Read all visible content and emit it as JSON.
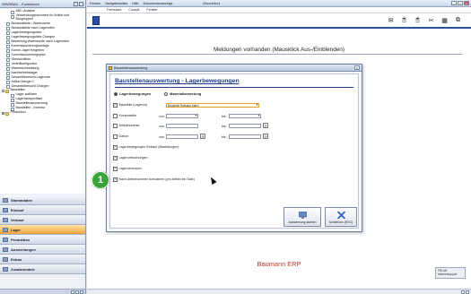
{
  "left_panel": {
    "title": "WWSBAU - Funktionen",
    "tree": [
      {
        "label": "ABC-Analyse",
        "type": "doc",
        "indent": 2
      },
      {
        "label": "Verwendungsnachweis für Artikel und Baugruppen",
        "type": "doc",
        "indent": 2
      },
      {
        "label": "Bestandsliste / Warenwerte",
        "type": "doc",
        "indent": 1
      },
      {
        "label": "Bestandsliste nach Lagerorten",
        "type": "doc",
        "indent": 1
      },
      {
        "label": "Lagerbewegungsliste",
        "type": "doc",
        "indent": 1
      },
      {
        "label": "Lagerbewegungsliste Chargen",
        "type": "doc",
        "indent": 1
      },
      {
        "label": "Bewertung Warenwerte nach Lagerorten",
        "type": "doc",
        "indent": 1
      },
      {
        "label": "Kommissionierungsanlage",
        "type": "doc",
        "indent": 1
      },
      {
        "label": "Komm.-lager freigeben",
        "type": "doc",
        "indent": 1
      },
      {
        "label": "Kommissionierungsplan",
        "type": "doc",
        "indent": 1
      },
      {
        "label": "Übersichtliste",
        "type": "doc",
        "indent": 1
      },
      {
        "label": "Verteilkonfigurator",
        "type": "doc",
        "indent": 1
      },
      {
        "label": "Warenrückmeldung",
        "type": "doc",
        "indent": 1
      },
      {
        "label": "Nachbetriebslager",
        "type": "doc",
        "indent": 1
      },
      {
        "label": "Gesamtübersicht Lagerorte",
        "type": "doc",
        "indent": 1
      },
      {
        "label": "Artikel Menge 0",
        "type": "doc",
        "indent": 1
      },
      {
        "label": "Gesamtübersicht Chargen",
        "type": "doc",
        "indent": 1
      },
      {
        "label": "Baustellen",
        "type": "folder",
        "indent": 0,
        "expander": "−"
      },
      {
        "label": "Lager auflösen",
        "type": "doc",
        "indent": 2
      },
      {
        "label": "Lagertransportliste",
        "type": "doc",
        "indent": 2
      },
      {
        "label": "Baustellenauswertung",
        "type": "doc",
        "indent": 2
      },
      {
        "label": "Baustellen - Inventur",
        "type": "doc",
        "indent": 2
      },
      {
        "label": "Produktion",
        "type": "folder",
        "indent": 0,
        "expander": "+"
      }
    ],
    "modules": [
      {
        "label": "Stammdaten",
        "active": false
      },
      {
        "label": "Einkauf",
        "active": false
      },
      {
        "label": "Verkauf",
        "active": false
      },
      {
        "label": "Lager",
        "active": true
      },
      {
        "label": "Produktion",
        "active": false
      },
      {
        "label": "Auswertungen",
        "active": false
      },
      {
        "label": "Extras",
        "active": false
      },
      {
        "label": "Zusatzmodule",
        "active": false
      }
    ]
  },
  "main": {
    "titlebar_menu": [
      "Fenster",
      "Navigationsliste",
      "Hilfe",
      "Dokumentenanzeige"
    ],
    "window_title": "[Baustellen]",
    "menu": [
      "Formulare",
      "Cockpit",
      "Fenster"
    ],
    "toolbar_icons": [
      "envelope-icon",
      "mouse-icon",
      "mouse-icon",
      "tools-icon",
      "chart-icon",
      "windows-icon"
    ],
    "meldungen": "Meldungen vorhanden  (Mausklick Aus-/Einblenden)",
    "brand": "Baumann ERP",
    "ribbon_text": "FBLAN\nInternetsupport"
  },
  "dialog": {
    "title": "Baustellenauswertung",
    "heading": "Baustellenauswertung - Lagerbewegungen",
    "radio_lager": "Lagerbewegungen",
    "radio_material": "Materialbewertung",
    "radio_selected": "lager",
    "rows": {
      "baustelle": {
        "label": "Baustelle (Lagerort)",
        "checked": true,
        "value": "Baustelle Rathaus Aalen"
      },
      "kostenstelle": {
        "label": "Kostenstelle",
        "checked": false,
        "von_label": "von:",
        "bis_label": "bis:"
      },
      "artikelnummer": {
        "label": "Artikelnummer",
        "checked": false,
        "von_label": "von:",
        "bis_label": "bis:"
      },
      "datum": {
        "label": "Datum",
        "checked": false,
        "von_label": "von:",
        "bis_label": "bis:"
      },
      "lagerbewegungen": {
        "label": "Lagerbewegungen Einkauf (Bestellungen)",
        "checked": true
      },
      "lagerumbuchungen": {
        "label": "Lagerumbuchungen",
        "checked": true
      },
      "lagerverbrauch": {
        "label": "Lagerverbrauch",
        "checked": true
      },
      "nachartikel": {
        "label": "Nach Artikelnummer kumulieren (pro Artikel ein Satz)",
        "checked": true
      }
    },
    "btn_start": "Auswertung starten",
    "btn_close": "Schließen (ESC)",
    "help_mark": "?"
  },
  "overlay": {
    "step_badge": "1"
  }
}
